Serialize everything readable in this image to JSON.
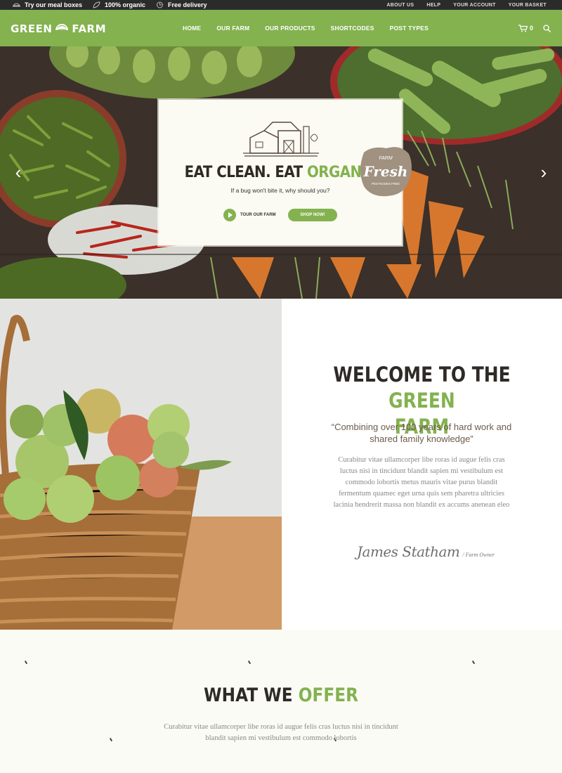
{
  "colors": {
    "brand_green": "#83b24f",
    "dark": "#2e2a26",
    "topbar": "#2b2b2b"
  },
  "topbar": {
    "promos": [
      {
        "icon": "meal-box-icon",
        "text": "Try our meal boxes"
      },
      {
        "icon": "leaf-icon",
        "text": "100% organic"
      },
      {
        "icon": "delivery-icon",
        "text": "Free delivery"
      }
    ],
    "links": [
      "ABOUT US",
      "HELP",
      "YOUR ACCOUNT",
      "YOUR BASKET"
    ]
  },
  "header": {
    "logo_left": "GREEN",
    "logo_right": "FARM",
    "nav": [
      "HOME",
      "OUR FARM",
      "OUR PRODUCTS",
      "SHORTCODES",
      "POST TYPES"
    ],
    "cart_count": "0"
  },
  "hero": {
    "headline_dark": "EAT CLEAN. EAT",
    "headline_green": "ORGANIC",
    "subtitle": "If a bug won't bite it, why should you?",
    "tour_label": "TOUR OUR FARM",
    "shop_label": "SHOP NOW!",
    "badge_top": "FARM",
    "badge_main": "Fresh",
    "badge_bottom": "PESTICIDES FREE"
  },
  "welcome": {
    "title_dark": "WELCOME TO THE",
    "title_green_1": "GREEN",
    "title_green_2": "FARM",
    "quote": "“Combining over 100 years of hard work and shared family knowledge”",
    "body": "Curabitur vitae ullamcorper libe roras id augue felis cras luctus nisi in tincidunt blandit sapien mi vestibulum est commodo lobortis metus mauris vitae purus blandit fermentum quamec eget urna quis sem pharetra ultricies lacinia hendrerit massa non blandit ex accums anenean eleo",
    "signature": "James Statham",
    "role": "/ Farm Owner"
  },
  "offer": {
    "title_dark": "WHAT WE",
    "title_green": "OFFER",
    "body": "Curabitur vitae ullamcorper libe roras id augue felis cras luctus nisi in tincidunt blandit sapien mi vestibulum est commodo lobortis"
  }
}
